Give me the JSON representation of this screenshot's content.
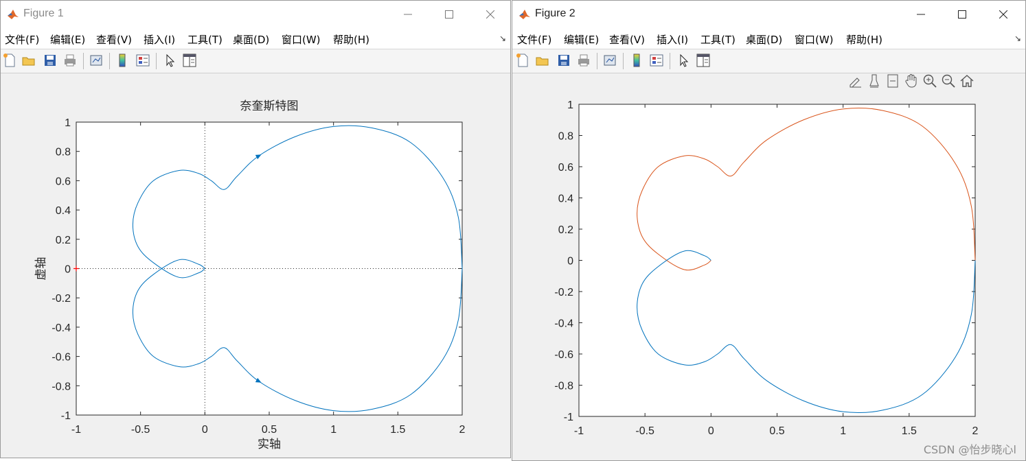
{
  "figure1": {
    "title": "Figure 1",
    "menu": [
      "文件(F)",
      "编辑(E)",
      "查看(V)",
      "插入(I)",
      "工具(T)",
      "桌面(D)",
      "窗口(W)",
      "帮助(H)"
    ],
    "axes_title": "奈奎斯特图",
    "xlabel": "实轴",
    "ylabel": "虚轴"
  },
  "figure2": {
    "title": "Figure 2",
    "menu": [
      "文件(F)",
      "编辑(E)",
      "查看(V)",
      "插入(I)",
      "工具(T)",
      "桌面(D)",
      "窗口(W)",
      "帮助(H)"
    ]
  },
  "watermark": "CSDN @怡步晓心l",
  "chart_data": [
    {
      "type": "line",
      "title": "奈奎斯特图",
      "xlabel": "实轴",
      "ylabel": "虚轴",
      "xlim": [
        -1,
        2
      ],
      "ylim": [
        -1,
        1
      ],
      "xticks": [
        "-1",
        "-0.5",
        "0",
        "0.5",
        "1",
        "1.5",
        "2"
      ],
      "yticks": [
        "-1",
        "-0.8",
        "-0.6",
        "-0.4",
        "-0.2",
        "0",
        "0.2",
        "0.4",
        "0.6",
        "0.8",
        "1"
      ],
      "grid": false,
      "series": [
        {
          "color": "#0072bd",
          "points": [
            [
              2,
              0
            ],
            [
              1.97,
              0.35
            ],
            [
              1.85,
              0.62
            ],
            [
              1.6,
              0.86
            ],
            [
              1.3,
              0.96
            ],
            [
              1.0,
              0.97
            ],
            [
              0.7,
              0.9
            ],
            [
              0.42,
              0.77
            ],
            [
              0.25,
              0.63
            ],
            [
              0.15,
              0.54
            ],
            [
              0.05,
              0.6
            ],
            [
              -0.05,
              0.65
            ],
            [
              -0.2,
              0.67
            ],
            [
              -0.4,
              0.6
            ],
            [
              -0.52,
              0.45
            ],
            [
              -0.56,
              0.3
            ],
            [
              -0.52,
              0.15
            ],
            [
              -0.4,
              0.04
            ],
            [
              -0.2,
              -0.06
            ],
            [
              -0.05,
              -0.03
            ],
            [
              0,
              0
            ]
          ]
        },
        {
          "color": "#0072bd",
          "points": [
            [
              2,
              0
            ],
            [
              1.97,
              -0.35
            ],
            [
              1.85,
              -0.62
            ],
            [
              1.6,
              -0.86
            ],
            [
              1.3,
              -0.96
            ],
            [
              1.0,
              -0.97
            ],
            [
              0.7,
              -0.9
            ],
            [
              0.42,
              -0.77
            ],
            [
              0.25,
              -0.63
            ],
            [
              0.15,
              -0.54
            ],
            [
              0.05,
              -0.6
            ],
            [
              -0.05,
              -0.65
            ],
            [
              -0.2,
              -0.67
            ],
            [
              -0.4,
              -0.6
            ],
            [
              -0.52,
              -0.45
            ],
            [
              -0.56,
              -0.3
            ],
            [
              -0.52,
              -0.15
            ],
            [
              -0.4,
              -0.04
            ],
            [
              -0.2,
              0.06
            ],
            [
              -0.05,
              0.03
            ],
            [
              0,
              0
            ]
          ]
        }
      ],
      "critical_point": [
        -1,
        0
      ]
    },
    {
      "type": "line",
      "xlim": [
        -1,
        2
      ],
      "ylim": [
        -1,
        1
      ],
      "xticks": [
        "-1",
        "-0.5",
        "0",
        "0.5",
        "1",
        "1.5",
        "2"
      ],
      "yticks": [
        "-1",
        "-0.8",
        "-0.6",
        "-0.4",
        "-0.2",
        "0",
        "0.2",
        "0.4",
        "0.6",
        "0.8",
        "1"
      ],
      "grid": false,
      "series": [
        {
          "color": "#d95319",
          "points": [
            [
              2,
              0
            ],
            [
              1.97,
              0.35
            ],
            [
              1.85,
              0.62
            ],
            [
              1.6,
              0.86
            ],
            [
              1.3,
              0.96
            ],
            [
              1.0,
              0.97
            ],
            [
              0.7,
              0.9
            ],
            [
              0.42,
              0.77
            ],
            [
              0.25,
              0.63
            ],
            [
              0.15,
              0.54
            ],
            [
              0.05,
              0.6
            ],
            [
              -0.05,
              0.65
            ],
            [
              -0.2,
              0.67
            ],
            [
              -0.4,
              0.6
            ],
            [
              -0.52,
              0.45
            ],
            [
              -0.56,
              0.3
            ],
            [
              -0.52,
              0.15
            ],
            [
              -0.4,
              0.04
            ],
            [
              -0.2,
              -0.06
            ],
            [
              -0.05,
              -0.03
            ],
            [
              0,
              0
            ]
          ]
        },
        {
          "color": "#0072bd",
          "points": [
            [
              2,
              0
            ],
            [
              1.97,
              -0.35
            ],
            [
              1.85,
              -0.62
            ],
            [
              1.6,
              -0.86
            ],
            [
              1.3,
              -0.96
            ],
            [
              1.0,
              -0.97
            ],
            [
              0.7,
              -0.9
            ],
            [
              0.42,
              -0.77
            ],
            [
              0.25,
              -0.63
            ],
            [
              0.15,
              -0.54
            ],
            [
              0.05,
              -0.6
            ],
            [
              -0.05,
              -0.65
            ],
            [
              -0.2,
              -0.67
            ],
            [
              -0.4,
              -0.6
            ],
            [
              -0.52,
              -0.45
            ],
            [
              -0.56,
              -0.3
            ],
            [
              -0.52,
              -0.15
            ],
            [
              -0.4,
              -0.04
            ],
            [
              -0.2,
              0.06
            ],
            [
              -0.05,
              0.03
            ],
            [
              0,
              0
            ]
          ]
        }
      ]
    }
  ]
}
